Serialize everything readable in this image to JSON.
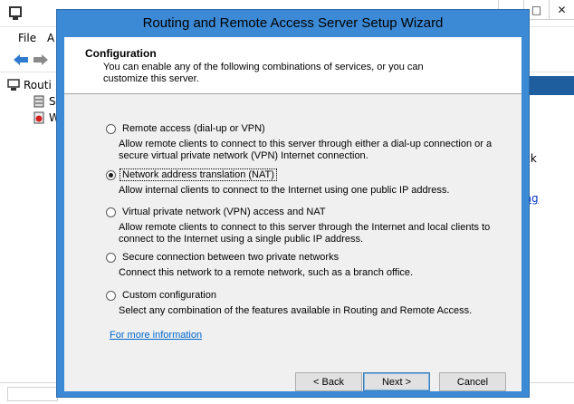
{
  "background_window": {
    "menu": [
      "File",
      "A"
    ],
    "window_buttons": [
      "–",
      "□",
      "✕"
    ],
    "tree": [
      "Routi",
      "Se",
      "W"
    ],
    "right_pane_text": "ick",
    "right_pane_link": "ing"
  },
  "wizard": {
    "title": "Routing and Remote Access Server Setup Wizard",
    "header": {
      "title": "Configuration",
      "subtitle": "You can enable any of the following combinations of services, or you can customize this server."
    },
    "options": [
      {
        "label": "Remote access (dial-up or VPN)",
        "description": "Allow remote clients to connect to this server through either a dial-up connection or a secure virtual private network (VPN) Internet connection.",
        "selected": false
      },
      {
        "label": "Network address translation (NAT)",
        "description": "Allow internal clients to connect to the Internet using one public IP address.",
        "selected": true
      },
      {
        "label": "Virtual private network (VPN) access and NAT",
        "description": "Allow remote clients to connect to this server through the Internet and local clients to connect to the Internet using a single public IP address.",
        "selected": false
      },
      {
        "label": "Secure connection between two private networks",
        "description": "Connect this network to a remote network, such as a branch office.",
        "selected": false
      },
      {
        "label": "Custom configuration",
        "description": "Select any combination of the features available in Routing and Remote Access.",
        "selected": false
      }
    ],
    "more_info_link": "For more information",
    "buttons": {
      "back": "< Back",
      "next": "Next >",
      "cancel": "Cancel"
    }
  }
}
